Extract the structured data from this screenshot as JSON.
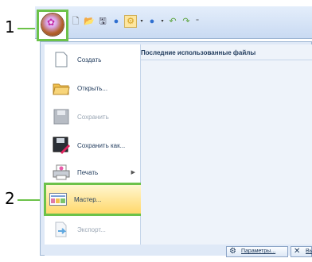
{
  "callouts": {
    "one": "1",
    "two": "2"
  },
  "app_button": {
    "icon": "app-menu-orb-icon"
  },
  "quick_access": [
    "new-icon",
    "open-icon",
    "save-icon",
    "circle-icon",
    "settings-icon",
    "color-icon",
    "undo-icon",
    "redo-icon",
    "customize-icon"
  ],
  "recent": {
    "title": "Последние использованные файлы"
  },
  "menu": {
    "items": [
      {
        "label": "Создать",
        "icon": "new-document-icon"
      },
      {
        "label": "Открыть...",
        "icon": "open-folder-icon"
      },
      {
        "label": "Сохранить",
        "icon": "save-icon",
        "disabled": true
      },
      {
        "label": "Сохранить как...",
        "icon": "save-as-icon"
      },
      {
        "label": "Печать",
        "icon": "print-icon",
        "submenu": true
      },
      {
        "label": "Мастер...",
        "icon": "wizard-icon",
        "highlighted": true
      },
      {
        "label": "Экспорт...",
        "icon": "export-icon",
        "disabled": true
      }
    ]
  },
  "footer": {
    "params_label": "Параметры...",
    "exit_label": "Вы"
  },
  "colors": {
    "highlight": "#6cc24a",
    "ribbon": "#dfe9f7"
  }
}
